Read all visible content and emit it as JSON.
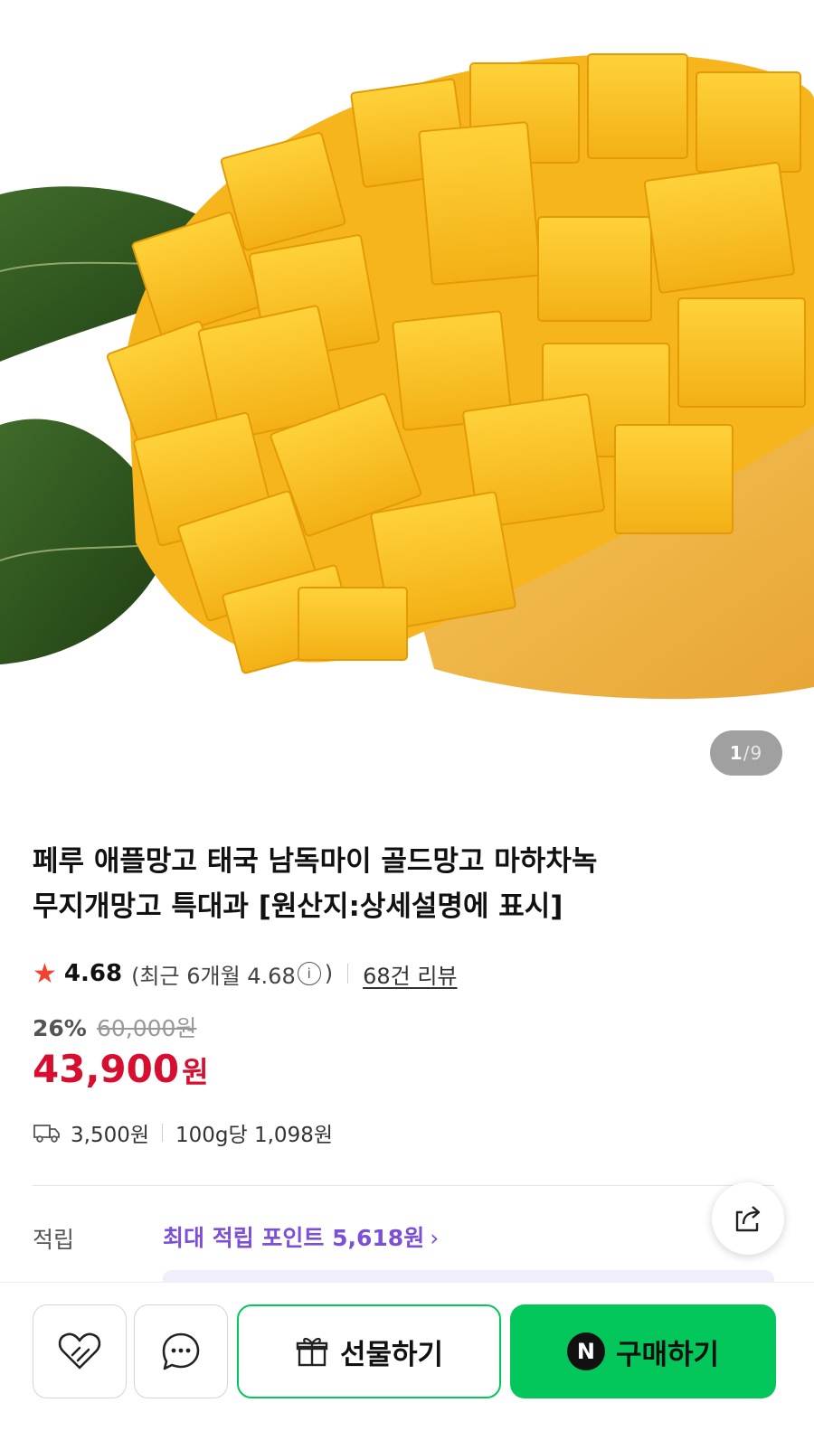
{
  "gallery": {
    "image_alt": "mango-product-photo",
    "current": "1",
    "separator": "/",
    "total": "9"
  },
  "product": {
    "title_line1": "페루 애플망고 태국 남독마이 골드망고 마하차녹",
    "title_line2": "무지개망고 특대과 [원산지:상세설명에 표시]"
  },
  "rating": {
    "score": "4.68",
    "recent_prefix": "(최근 6개월 4.68",
    "info_icon": "ⓘ",
    "recent_suffix": ")",
    "review_link": "68건 리뷰"
  },
  "price": {
    "discount": "26%",
    "original": "60,000원",
    "sale": "43,900",
    "currency": "원"
  },
  "shipping": {
    "fee": "3,500원",
    "unit_price": "100g당 1,098원"
  },
  "points": {
    "label": "적립",
    "value": "최대 적립 포인트 5,618원",
    "chevron": "›"
  },
  "bottom": {
    "gift_label": "선물하기",
    "buy_label": "구매하기",
    "npay_badge": "N"
  },
  "colors": {
    "sale_red": "#d70e2f",
    "point_purple": "#7b4fd6",
    "naver_green": "#03c75a"
  }
}
